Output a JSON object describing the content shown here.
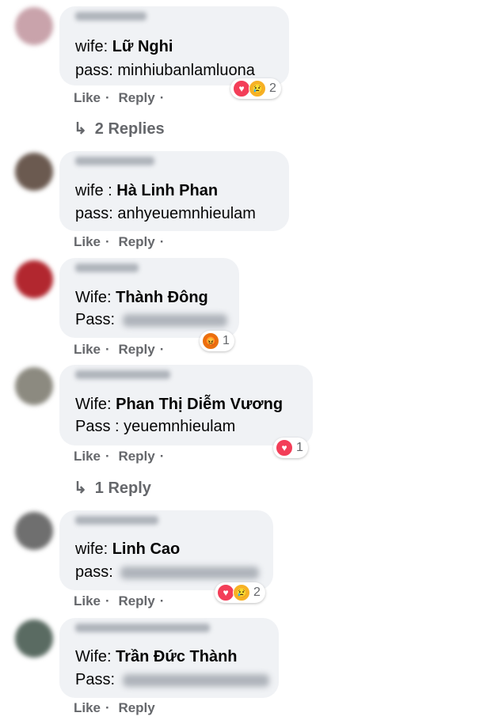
{
  "actions": {
    "like": "Like",
    "reply": "Reply",
    "sep": "·"
  },
  "comments": [
    {
      "label": "wife:",
      "name": "Lữ Nghi",
      "pass_label": "pass:",
      "pass": "minhiubanlamluona",
      "reaction_count": "2",
      "replies": "2 Replies"
    },
    {
      "label": "wife :",
      "name": "Hà Linh Phan",
      "pass_label": "pass:",
      "pass": "anhyeuemnhieulam"
    },
    {
      "label": "Wife:",
      "name": "Thành Đông",
      "pass_label": "Pass:",
      "pass": "",
      "reaction_count": "1"
    },
    {
      "label": "Wife:",
      "name": "Phan Thị Diễm Vương",
      "pass_label": "Pass :",
      "pass": "yeuemnhieulam",
      "reaction_count": "1",
      "replies": "1 Reply"
    },
    {
      "label": "wife:",
      "name": "Linh Cao",
      "pass_label": "pass:",
      "pass": "",
      "reaction_count": "2"
    },
    {
      "label": "Wife:",
      "name": "Trần Đức Thành",
      "pass_label": "Pass:",
      "pass": ""
    }
  ],
  "icons": {
    "reply_arrow": "↳",
    "heart": "♥",
    "sad": "😢",
    "angry": "😡"
  },
  "colors": {
    "bubble": "#f0f2f5",
    "meta": "#65676b",
    "heart": "#f33e58",
    "sad": "#f7b125",
    "angry": "#e9710f"
  }
}
